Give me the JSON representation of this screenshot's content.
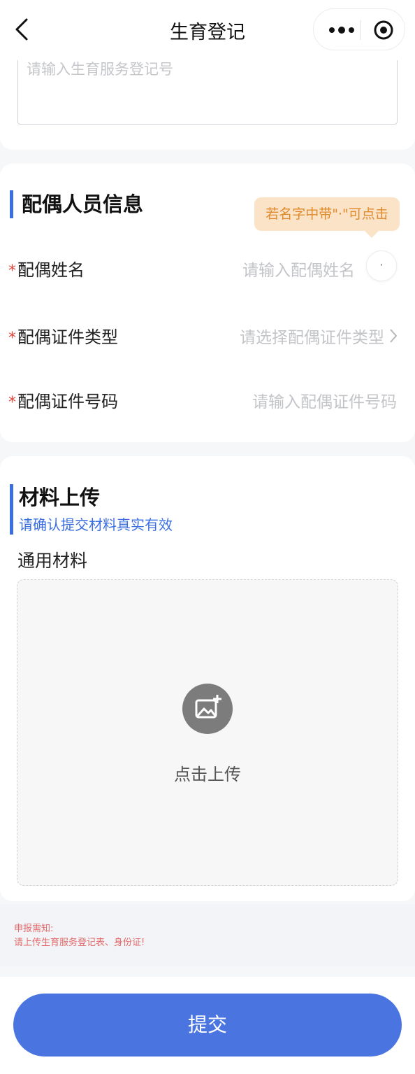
{
  "nav": {
    "title": "生育登记"
  },
  "registration": {
    "placeholder": "请输入生育服务登记号"
  },
  "spouse": {
    "section_title": "配偶人员信息",
    "tooltip": "若名字中带\"·\"可点击",
    "dot_button": "·",
    "fields": [
      {
        "label": "配偶姓名",
        "placeholder": "请输入配偶姓名",
        "required": "*"
      },
      {
        "label": "配偶证件类型",
        "placeholder": "请选择配偶证件类型",
        "required": "*"
      },
      {
        "label": "配偶证件号码",
        "placeholder": "请输入配偶证件号码",
        "required": "*"
      }
    ]
  },
  "materials": {
    "section_title": "材料上传",
    "hint": "请确认提交材料真实有效",
    "group_label": "通用材料",
    "upload_text": "点击上传"
  },
  "notice": {
    "title": "申报需知:",
    "text": "请上传生育服务登记表、身份证!"
  },
  "submit_label": "提交",
  "colors": {
    "accent": "#4a74e0",
    "required": "#e0463c",
    "tooltip_bg": "#fbe3c8",
    "tooltip_text": "#e08a2c",
    "notice_text": "#e26a6a"
  }
}
